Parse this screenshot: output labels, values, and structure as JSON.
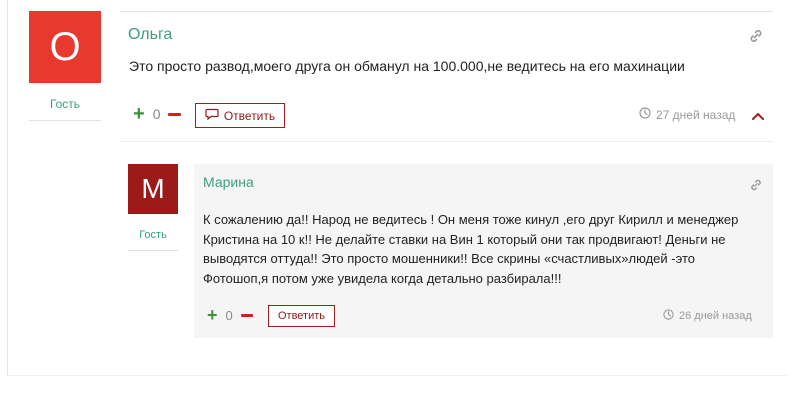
{
  "comments": [
    {
      "author": "Ольга",
      "avatar_letter": "О",
      "avatar_color": "#e8392e",
      "role": "Гость",
      "text": "Это просто развод,моего друга он обманул на 100.000,не ведитесь на его махинации",
      "vote_plus": "+",
      "vote_count": "0",
      "reply_label": "Ответить",
      "time": "27 дней назад",
      "icons": [
        "link-icon",
        "comment-icon",
        "clock-icon",
        "chevron-up-icon"
      ]
    },
    {
      "author": "Марина",
      "avatar_letter": "М",
      "avatar_color": "#9b1b1b",
      "role": "Гость",
      "text": "К сожалению да!! Народ не ведитесь ! Он меня тоже кинул ,его друг Кирилл и менеджер Кристина на 10 к!! Не делайте ставки на Вин 1 который они так продвигают! Деньги не выводятся оттуда!! Это просто мошенники!! Все скрины «счастливых»людей -это Фотошоп,я потом уже увидела когда детально разбирала!!!",
      "vote_plus": "+",
      "vote_count": "0",
      "reply_label": "Ответить",
      "time": "26 дней назад",
      "icons": [
        "link-icon",
        "clock-icon"
      ]
    }
  ]
}
